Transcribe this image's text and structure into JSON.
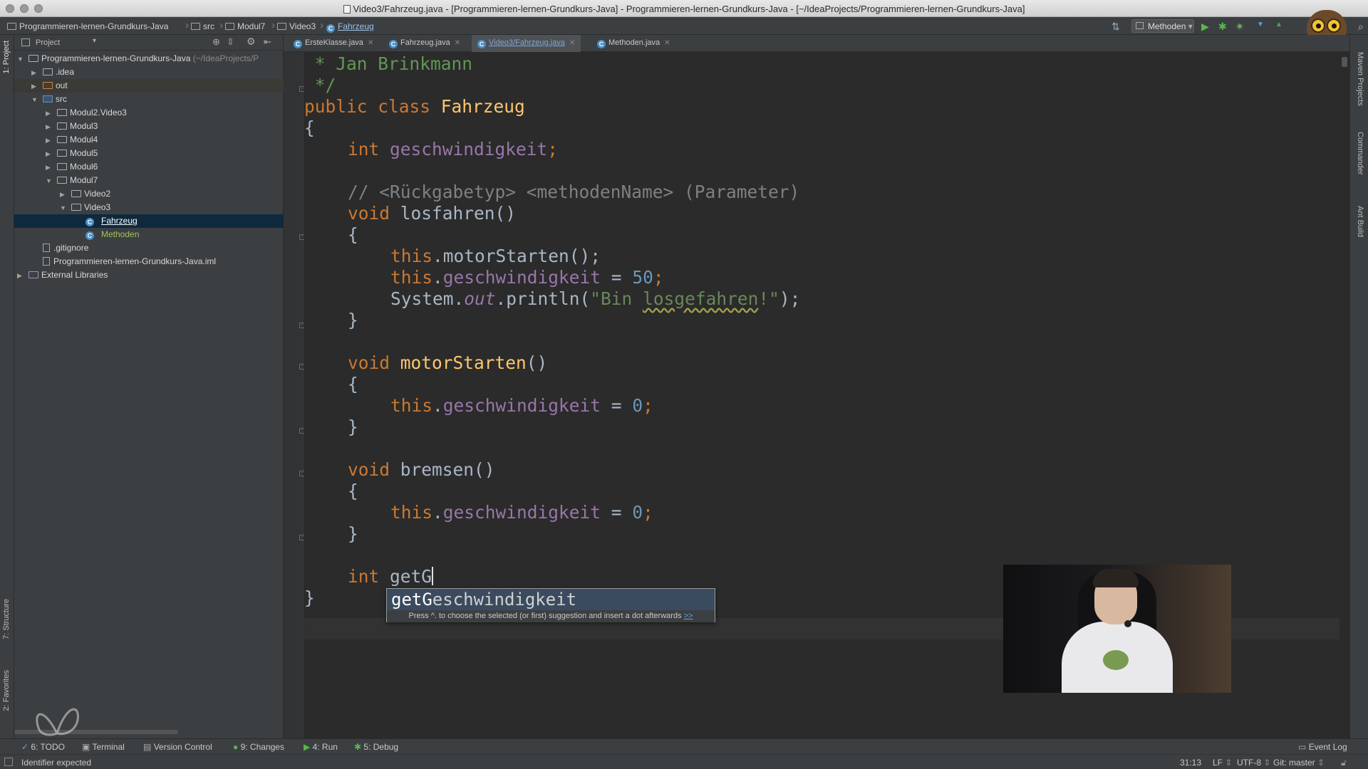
{
  "window": {
    "title": "Video3/Fahrzeug.java - [Programmieren-lernen-Grundkurs-Java] - Programmieren-lernen-Grundkurs-Java - [~/IdeaProjects/Programmieren-lernen-Grundkurs-Java]"
  },
  "navbar": {
    "breadcrumbs": [
      "Programmieren-lernen-Grundkurs-Java",
      "src",
      "Modul7",
      "Video3",
      "Fahrzeug"
    ],
    "run_config": "Methoden"
  },
  "left_stripe": {
    "project": "1: Project",
    "structure": "7: Structure",
    "favorites": "2: Favorites"
  },
  "project_panel": {
    "title": "Project",
    "tree": [
      {
        "label": "Programmieren-lernen-Grundkurs-Java",
        "hint": "(~/IdeaProjects/P",
        "kind": "folder"
      },
      {
        "label": ".idea",
        "kind": "folder"
      },
      {
        "label": "out",
        "kind": "folder-out"
      },
      {
        "label": "src",
        "kind": "folder-src"
      },
      {
        "label": "Modul2.Video3",
        "kind": "folder"
      },
      {
        "label": "Modul3",
        "kind": "folder"
      },
      {
        "label": "Modul4",
        "kind": "folder"
      },
      {
        "label": "Modul5",
        "kind": "folder"
      },
      {
        "label": "Modul6",
        "kind": "folder"
      },
      {
        "label": "Modul7",
        "kind": "folder"
      },
      {
        "label": "Video2",
        "kind": "folder"
      },
      {
        "label": "Video3",
        "kind": "folder"
      },
      {
        "label": "Fahrzeug",
        "kind": "class"
      },
      {
        "label": "Methoden",
        "kind": "class"
      },
      {
        "label": ".gitignore",
        "kind": "file"
      },
      {
        "label": "Programmieren-lernen-Grundkurs-Java.iml",
        "kind": "file"
      },
      {
        "label": "External Libraries",
        "kind": "lib"
      }
    ]
  },
  "tabs": [
    {
      "label": "ErsteKlasse.java"
    },
    {
      "label": "Fahrzeug.java"
    },
    {
      "label": "Video3/Fahrzeug.java"
    },
    {
      "label": "Methoden.java"
    }
  ],
  "editor": {
    "author_line": " * Jan Brinkmann",
    "doc_end": " */",
    "l_class_kw": "public class ",
    "l_class_name": "Fahrzeug",
    "brace_open": "{",
    "brace_close": "}",
    "kw_int": "int ",
    "kw_void": "void ",
    "field": "geschwindigkeit",
    "semi": ";",
    "comment": "// <Rückgabetyp> <methodenName> (Parameter)",
    "m_losfahren": "losfahren",
    "m_motorStarten": "motorStarten",
    "m_bremsen": "bremsen",
    "parens": "()",
    "this_kw": "this",
    "dot": ".",
    "call_motor": "motorStarten();",
    "assign": " = ",
    "num_50": "50",
    "num_0": "0",
    "sys": "System.",
    "out": "out",
    "println_open": ".println(",
    "str_bin": "\"Bin ",
    "str_los": "losgefahren",
    "str_end": "!\"",
    "close_stmt": ");",
    "typed": "getG"
  },
  "autocomplete": {
    "match": "getG",
    "rest": "eschwindigkeit",
    "hint": "Press ^. to choose the selected (or first) suggestion and insert a dot afterwards",
    "more": ">>"
  },
  "right_stripe": {
    "maven": "Maven Projects",
    "commander": "Commander",
    "ant": "Ant Build"
  },
  "bottom_bar": {
    "todo": "6: TODO",
    "terminal": "Terminal",
    "vcs": "Version Control",
    "changes": "9: Changes",
    "run": "4: Run",
    "debug": "5: Debug",
    "event_log": "Event Log"
  },
  "status_bar": {
    "message": "Identifier expected",
    "position": "31:13",
    "line_sep": "LF",
    "encoding": "UTF-8",
    "git": "Git: master"
  }
}
